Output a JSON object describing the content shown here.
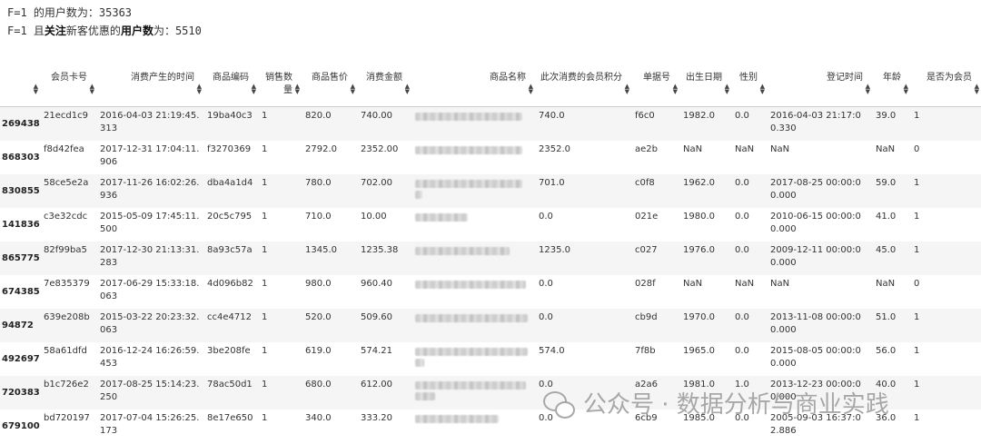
{
  "output_lines": {
    "line1": "F=1 的用户数为：35363",
    "line2_prefix": "F=1 且",
    "line2_bold1": "关注",
    "line2_mid": "新客优惠的",
    "line2_bold2": "用户数",
    "line2_suffix": "为：5510"
  },
  "table": {
    "headers": [
      "会员卡号",
      "消费产生的时间",
      "商品编码",
      "销售数量",
      "商品售价",
      "消费金额",
      "商品名称",
      "此次消费的会员积分",
      "单据号",
      "出生日期",
      "性别",
      "登记时间",
      "年龄",
      "是否为会员"
    ],
    "rows": [
      {
        "idx": "269438",
        "cells": [
          "21ecd1c9",
          "2016-04-03 21:19:45.313",
          "19ba40c3",
          "1",
          "820.0",
          "740.00",
          "",
          "740.0",
          "f6c0",
          "1982.0",
          "0.0",
          "2016-04-03 21:17:00.330",
          "39.0",
          "1"
        ]
      },
      {
        "idx": "868303",
        "cells": [
          "f8d42fea",
          "2017-12-31 17:04:11.906",
          "f3270369",
          "1",
          "2792.0",
          "2352.00",
          "",
          "2352.0",
          "ae2b",
          "NaN",
          "NaN",
          "NaN",
          "NaN",
          "0"
        ]
      },
      {
        "idx": "830855",
        "cells": [
          "58ce5e2a",
          "2017-11-26 16:02:26.936",
          "dba4a1d4",
          "1",
          "780.0",
          "702.00",
          "",
          "701.0",
          "c0f8",
          "1962.0",
          "0.0",
          "2017-08-25 00:00:00.000",
          "59.0",
          "1"
        ]
      },
      {
        "idx": "141836",
        "cells": [
          "c3e32cdc",
          "2015-05-09 17:45:11.500",
          "20c5c795",
          "1",
          "710.0",
          "10.00",
          "",
          "0.0",
          "021e",
          "1980.0",
          "0.0",
          "2010-06-15 00:00:00.000",
          "41.0",
          "1"
        ]
      },
      {
        "idx": "865775",
        "cells": [
          "82f99ba5",
          "2017-12-30 21:13:31.283",
          "8a93c57a",
          "1",
          "1345.0",
          "1235.38",
          "",
          "1235.0",
          "c027",
          "1976.0",
          "0.0",
          "2009-12-11 00:00:00.000",
          "45.0",
          "1"
        ]
      },
      {
        "idx": "674385",
        "cells": [
          "7e835379",
          "2017-06-29 15:33:18.063",
          "4d096b82",
          "1",
          "980.0",
          "960.40",
          "",
          "0.0",
          "028f",
          "NaN",
          "NaN",
          "NaN",
          "NaN",
          "0"
        ]
      },
      {
        "idx": "94872",
        "cells": [
          "639e208b",
          "2015-03-22 20:23:32.063",
          "cc4e4712",
          "1",
          "520.0",
          "509.60",
          "",
          "0.0",
          "cb9d",
          "1970.0",
          "0.0",
          "2013-11-08 00:00:00.000",
          "51.0",
          "1"
        ]
      },
      {
        "idx": "492697",
        "cells": [
          "58a61dfd",
          "2016-12-24 16:26:59.453",
          "3be208fe",
          "1",
          "619.0",
          "574.21",
          "",
          "574.0",
          "7f8b",
          "1965.0",
          "0.0",
          "2015-08-05 00:00:00.000",
          "56.0",
          "1"
        ]
      },
      {
        "idx": "720383",
        "cells": [
          "b1c726e2",
          "2017-08-25 15:14:23.250",
          "78ac50d1",
          "1",
          "680.0",
          "612.00",
          "",
          "0.0",
          "a2a6",
          "1981.0",
          "1.0",
          "2013-12-23 00:00:00.000",
          "40.0",
          "1"
        ]
      },
      {
        "idx": "679100",
        "cells": [
          "bd720197",
          "2017-07-04 15:26:25.173",
          "8e17e650",
          "1",
          "340.0",
          "333.20",
          "",
          "0.0",
          "6cb9",
          "1985.0",
          "0.0",
          "2005-09-03 16:37:02.886",
          "36.0",
          "1"
        ]
      }
    ],
    "sort_icon": "sort-updown-icon"
  },
  "watermark": {
    "text": "公众号 · 数据分析与商业实践",
    "icon": "wechat-icon"
  }
}
